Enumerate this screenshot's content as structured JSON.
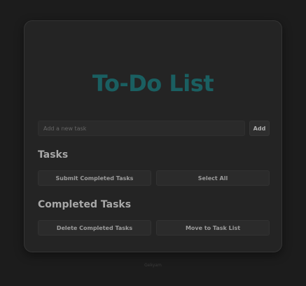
{
  "title": "To-Do List",
  "new_task": {
    "placeholder": "Add a new task",
    "value": "",
    "add_label": "Add"
  },
  "tasks": {
    "heading": "Tasks",
    "submit_label": "Submit Completed Tasks",
    "select_all_label": "Select All"
  },
  "completed": {
    "heading": "Completed Tasks",
    "delete_label": "Delete Completed Tasks",
    "move_label": "Move to Task List"
  },
  "footer": {
    "text": "Gekyam"
  },
  "colors": {
    "title": "#1a5f61",
    "background": "#1c1c1c",
    "card": "#242424"
  }
}
